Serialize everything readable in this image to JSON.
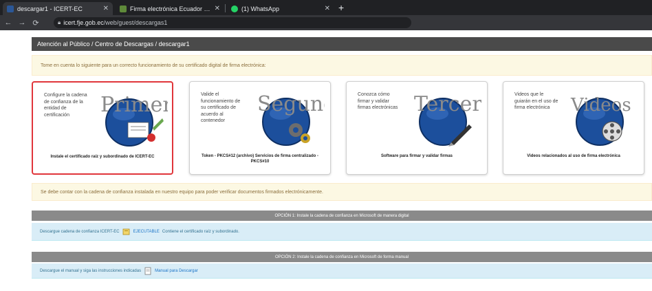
{
  "browser": {
    "tabs": [
      {
        "title": "descargar1 - ICERT-EC",
        "active": true,
        "favicon_color": "#2b5797"
      },
      {
        "title": "Firma electrónica Ecuador Secu...",
        "active": false,
        "favicon_color": "#5f8a3a"
      },
      {
        "title": "(1) WhatsApp",
        "active": false,
        "favicon_color": "#25d366"
      }
    ],
    "new_tab_icon": "+",
    "address": {
      "host": "icert.fje.gob.ec",
      "path": "/web/guest/descargas1"
    }
  },
  "page": {
    "breadcrumb": "Atención al Público / Centro de Descargas / descargar1",
    "notice_top": "Tome en cuenta lo siguiente para un correcto funcionamiento de su certificado digital de firma electrónica:",
    "notice_mid": "Se debe contar con la cadena de confianza instalada en nuestro equipo para poder verificar documentos firmados electrónicamente.",
    "cards": [
      {
        "text": "Configure la cadena de confianza de la entidad de certificación",
        "label": "Instale el certificado raíz y subordinado de ICERT-EC",
        "logo_word": "Primer0",
        "icon": "certificate-icon",
        "selected": true
      },
      {
        "text": "Valide el funcionamiento de su certificado de acuerdo al contenedor",
        "label": "Token - PKCS#12 (archivo) Servicios de firma centralizado - PKCS#10",
        "logo_word": "Segund0",
        "icon": "gears-icon",
        "selected": false
      },
      {
        "text": "Conozca cómo firmar y validar firmas electrónicas",
        "label": "Software para firmar y validar firmas",
        "logo_word": "Tercer0",
        "icon": "pen-icon",
        "selected": false
      },
      {
        "text": "Videos que le guiarán en el uso de firma electrónica",
        "label": "Videos relacionados al uso de firma electrónica",
        "logo_word": "Videos",
        "icon": "film-reel-icon",
        "selected": false
      }
    ],
    "options": [
      {
        "header": "OPCIÓN 1: Instale la cadena de confianza en Microsoft de manera digital",
        "text": "Descargue cadena de confianza ICERT-EC",
        "link": "EJECUTABLE",
        "after": "Contiene el certificado raíz y subordinado."
      },
      {
        "header": "OPCIÓN 2: Instale la cadena de confianza en Microsoft de forma manual",
        "text": "Descargue el manual y siga las instrucciones indicadas",
        "link": "Manual para Descargar",
        "after": ""
      }
    ]
  },
  "colors": {
    "accent_red": "#e0353a",
    "globe_blue": "#1c4f9c",
    "notice_bg": "#fcf8e3",
    "info_bg": "#d9edf7"
  }
}
